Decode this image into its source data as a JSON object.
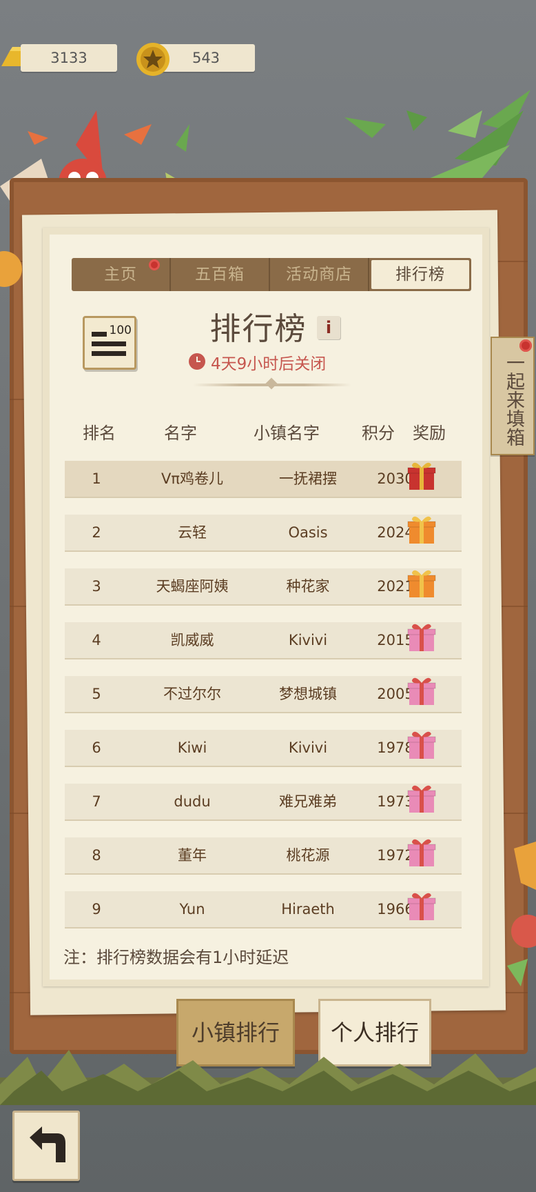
{
  "currency": {
    "gold": "3133",
    "coins": "543"
  },
  "tabs": [
    {
      "label": "主页",
      "active": false,
      "has_dot": true
    },
    {
      "label": "五百箱",
      "active": false,
      "has_dot": false
    },
    {
      "label": "活动商店",
      "active": false,
      "has_dot": false
    },
    {
      "label": "排行榜",
      "active": true,
      "has_dot": false
    }
  ],
  "header": {
    "rank_badge": "100",
    "title": "排行榜",
    "info": "i",
    "countdown": "4天9小时后关闭"
  },
  "columns": {
    "rank": "排名",
    "name": "名字",
    "town": "小镇名字",
    "score": "积分",
    "reward": "奖励"
  },
  "rows": [
    {
      "rank": "1",
      "name": "Vπ鸡卷儿",
      "town": "一抚裙摆",
      "score": "2030",
      "gift": "gift-red-icon"
    },
    {
      "rank": "2",
      "name": "云轻",
      "town": "Oasis",
      "score": "2024",
      "gift": "gift-orange-icon"
    },
    {
      "rank": "3",
      "name": "天蝎座阿姨",
      "town": "种花家",
      "score": "2021",
      "gift": "gift-orange-icon"
    },
    {
      "rank": "4",
      "name": "凯威威",
      "town": "Kivivi",
      "score": "2015",
      "gift": "gift-pink-icon"
    },
    {
      "rank": "5",
      "name": "不过尔尔",
      "town": "梦想城镇",
      "score": "2005",
      "gift": "gift-pink-icon"
    },
    {
      "rank": "6",
      "name": "Kiwi",
      "town": "Kivivi",
      "score": "1978",
      "gift": "gift-pink-icon"
    },
    {
      "rank": "7",
      "name": "dudu",
      "town": "难兄难弟",
      "score": "1973",
      "gift": "gift-pink-icon"
    },
    {
      "rank": "8",
      "name": "董年",
      "town": "桃花源",
      "score": "1972",
      "gift": "gift-pink-icon"
    },
    {
      "rank": "9",
      "name": "Yun",
      "town": "Hiraeth",
      "score": "1966",
      "gift": "gift-pink-icon"
    }
  ],
  "note": "注：排行榜数据会有1小时延迟",
  "buttons": {
    "town_rank": "小镇排行",
    "personal_rank": "个人排行"
  },
  "side_tab": "一起来填箱",
  "colors": {
    "board": "#a0663e",
    "paper": "#f6f1e0",
    "accent_red": "#c6564e",
    "text_brown": "#5b3d22"
  }
}
